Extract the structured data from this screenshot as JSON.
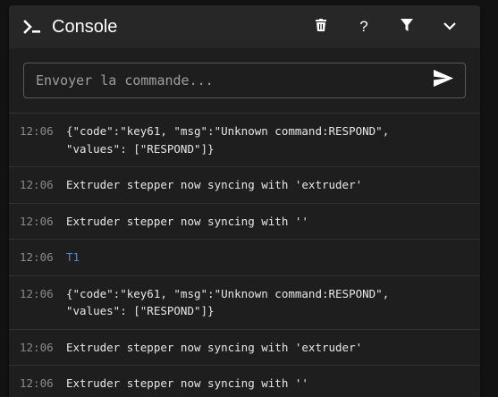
{
  "header": {
    "title": "Console",
    "icons": [
      "console-icon",
      "trash-icon",
      "help-icon",
      "filter-icon",
      "chevron-down-icon"
    ],
    "help_label": "?"
  },
  "command": {
    "placeholder": "Envoyer la commande...",
    "value": ""
  },
  "entries": [
    {
      "time": "12:06",
      "message": "{\"code\":\"key61, \"msg\":\"Unknown command:RESPOND\",\n\"values\": [\"RESPOND\"]}",
      "type": "response"
    },
    {
      "time": "12:06",
      "message": "Extruder stepper now syncing with 'extruder'",
      "type": "response"
    },
    {
      "time": "12:06",
      "message": "Extruder stepper now syncing with ''",
      "type": "response"
    },
    {
      "time": "12:06",
      "message": "T1",
      "type": "command"
    },
    {
      "time": "12:06",
      "message": "{\"code\":\"key61, \"msg\":\"Unknown command:RESPOND\",\n\"values\": [\"RESPOND\"]}",
      "type": "response"
    },
    {
      "time": "12:06",
      "message": "Extruder stepper now syncing with 'extruder'",
      "type": "response"
    },
    {
      "time": "12:06",
      "message": "Extruder stepper now syncing with ''",
      "type": "response"
    }
  ],
  "colors": {
    "background": "#121212",
    "card": "#1e1e1e",
    "header": "#272727",
    "timestamp": "#8a8a8a",
    "command_text": "#3d8fe6"
  }
}
